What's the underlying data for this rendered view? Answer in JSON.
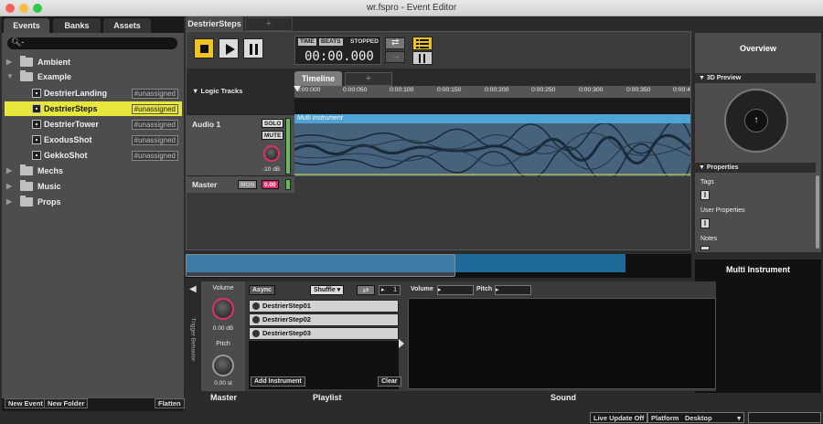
{
  "window": {
    "title": "wr.fspro - Event Editor"
  },
  "browser": {
    "tabs": [
      "Events",
      "Banks",
      "Assets"
    ],
    "search_placeholder": "",
    "tree": [
      {
        "label": "Ambient",
        "kind": "folder",
        "expanded": false
      },
      {
        "label": "Example",
        "kind": "folder",
        "expanded": true
      },
      {
        "label": "DestrierLanding",
        "kind": "event",
        "tag": "#unassigned"
      },
      {
        "label": "DestrierSteps",
        "kind": "event",
        "tag": "#unassigned",
        "selected": true
      },
      {
        "label": "DestrierTower",
        "kind": "event",
        "tag": "#unassigned"
      },
      {
        "label": "ExodusShot",
        "kind": "event",
        "tag": "#unassigned"
      },
      {
        "label": "GekkoShot",
        "kind": "event",
        "tag": "#unassigned"
      },
      {
        "label": "Mechs",
        "kind": "folder",
        "expanded": false
      },
      {
        "label": "Music",
        "kind": "folder",
        "expanded": false
      },
      {
        "label": "Props",
        "kind": "folder",
        "expanded": false
      }
    ],
    "buttons": {
      "new_event": "New Event",
      "new_folder": "New Folder",
      "flatten": "Flatten"
    }
  },
  "editor": {
    "event_tab": "DestrierSteps",
    "add_tab": "+",
    "transport": {
      "time_label": "TIME",
      "beats_label": "BEATS",
      "state": "STOPPED",
      "time": "00:00.000"
    },
    "timeline_tab": "Timeline",
    "logic_tracks": "Logic Tracks",
    "ruler_ticks": [
      "0:00:000",
      "0:00:050",
      "0:00:100",
      "0:00:150",
      "0:00:200",
      "0:00:250",
      "0:00:300",
      "0:00:350",
      "0:00:4"
    ],
    "tracks": {
      "audio_name": "Audio 1",
      "solo": "SOLO",
      "mute": "MUTE",
      "audio_db": "-10 dB",
      "master_name": "Master",
      "mon": "MON",
      "master_db": "0.00"
    },
    "region_label": "Multi Instrument"
  },
  "overview": {
    "title": "Overview",
    "preview_header": "3D Preview",
    "properties_header": "Properties",
    "tags_label": "Tags",
    "user_props_label": "User Properties",
    "notes_label": "Notes"
  },
  "deck": {
    "trigger_label": "Trigger Behavior",
    "master": {
      "volume_label": "Volume",
      "volume_value": "0.00 dB",
      "pitch_label": "Pitch",
      "pitch_value": "0.00 st"
    },
    "playlist": {
      "async": "Async",
      "mode": "Shuffle",
      "count": "1",
      "items": [
        "DestrierStep01",
        "DestrierStep02",
        "DestrierStep03"
      ],
      "item_icons": [
        "A",
        "B",
        "C"
      ],
      "add_instrument": "Add Instrument",
      "clear": "Clear"
    },
    "sound": {
      "volume_label": "Volume",
      "pitch_label": "Pitch"
    },
    "footers": {
      "master": "Master",
      "playlist": "Playlist",
      "sound": "Sound"
    },
    "instrument_title": "Multi Instrument"
  },
  "status": {
    "live_update": "Live Update Off",
    "platform_label": "Platform",
    "platform_value": "Desktop"
  },
  "colors": {
    "accent": "#e6e63c",
    "waveform": "#46627c",
    "region": "#4fa3d4",
    "stop": "#f0c419"
  }
}
